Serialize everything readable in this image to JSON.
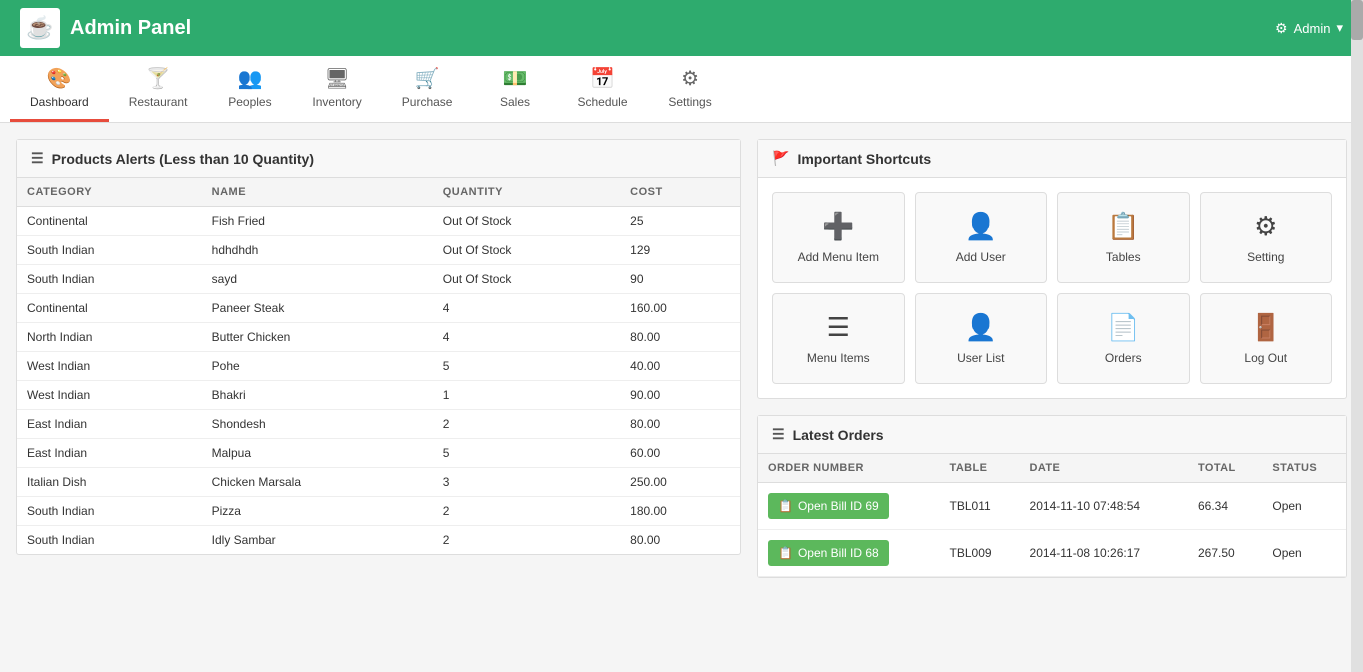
{
  "header": {
    "title": "Admin Panel",
    "logo": "☕",
    "admin_label": "Admin",
    "admin_dropdown": "▾",
    "gear_icon": "⚙"
  },
  "nav": {
    "items": [
      {
        "id": "dashboard",
        "label": "Dashboard",
        "icon": "🎨",
        "active": true
      },
      {
        "id": "restaurant",
        "label": "Restaurant",
        "icon": "🍸",
        "active": false
      },
      {
        "id": "peoples",
        "label": "Peoples",
        "icon": "👥",
        "active": false
      },
      {
        "id": "inventory",
        "label": "Inventory",
        "icon": "🖥",
        "active": false
      },
      {
        "id": "purchase",
        "label": "Purchase",
        "icon": "🛒",
        "active": false
      },
      {
        "id": "sales",
        "label": "Sales",
        "icon": "💵",
        "active": false
      },
      {
        "id": "schedule",
        "label": "Schedule",
        "icon": "📅",
        "active": false
      },
      {
        "id": "settings",
        "label": "Settings",
        "icon": "⚙",
        "active": false
      }
    ]
  },
  "products_panel": {
    "title": "Products Alerts (Less than 10 Quantity)",
    "columns": [
      "CATEGORY",
      "NAME",
      "QUANTITY",
      "COST"
    ],
    "rows": [
      {
        "category": "Continental",
        "name": "Fish Fried",
        "quantity": "Out Of Stock",
        "cost": "25"
      },
      {
        "category": "South Indian",
        "name": "hdhdhdh",
        "quantity": "Out Of Stock",
        "cost": "129"
      },
      {
        "category": "South Indian",
        "name": "sayd",
        "quantity": "Out Of Stock",
        "cost": "90"
      },
      {
        "category": "Continental",
        "name": "Paneer Steak",
        "quantity": "4",
        "cost": "160.00"
      },
      {
        "category": "North Indian",
        "name": "Butter Chicken",
        "quantity": "4",
        "cost": "80.00"
      },
      {
        "category": "West Indian",
        "name": "Pohe",
        "quantity": "5",
        "cost": "40.00"
      },
      {
        "category": "West Indian",
        "name": "Bhakri",
        "quantity": "1",
        "cost": "90.00"
      },
      {
        "category": "East Indian",
        "name": "Shondesh",
        "quantity": "2",
        "cost": "80.00"
      },
      {
        "category": "East Indian",
        "name": "Malpua",
        "quantity": "5",
        "cost": "60.00"
      },
      {
        "category": "Italian Dish",
        "name": "Chicken Marsala",
        "quantity": "3",
        "cost": "250.00"
      },
      {
        "category": "South Indian",
        "name": "Pizza",
        "quantity": "2",
        "cost": "180.00"
      },
      {
        "category": "South Indian",
        "name": "Idly Sambar",
        "quantity": "2",
        "cost": "80.00"
      }
    ]
  },
  "shortcuts": {
    "title": "Important Shortcuts",
    "items": [
      {
        "id": "add-menu-item",
        "label": "Add Menu Item",
        "icon": "➕"
      },
      {
        "id": "add-user",
        "label": "Add User",
        "icon": "👤"
      },
      {
        "id": "tables",
        "label": "Tables",
        "icon": "📋"
      },
      {
        "id": "setting",
        "label": "Setting",
        "icon": "⚙"
      },
      {
        "id": "menu-items",
        "label": "Menu Items",
        "icon": "☰"
      },
      {
        "id": "user-list",
        "label": "User List",
        "icon": "👤"
      },
      {
        "id": "orders",
        "label": "Orders",
        "icon": "📄"
      },
      {
        "id": "log-out",
        "label": "Log Out",
        "icon": "🚪"
      }
    ]
  },
  "latest_orders": {
    "title": "Latest Orders",
    "columns": [
      "ORDER NUMBER",
      "TABLE",
      "DATE",
      "TOTAL",
      "STATUS"
    ],
    "rows": [
      {
        "bill_label": "Open Bill ID 69",
        "table": "TBL011",
        "date": "2014-11-10 07:48:54",
        "total": "66.34",
        "status": "Open"
      },
      {
        "bill_label": "Open Bill ID 68",
        "table": "TBL009",
        "date": "2014-11-08 10:26:17",
        "total": "267.50",
        "status": "Open"
      }
    ]
  }
}
